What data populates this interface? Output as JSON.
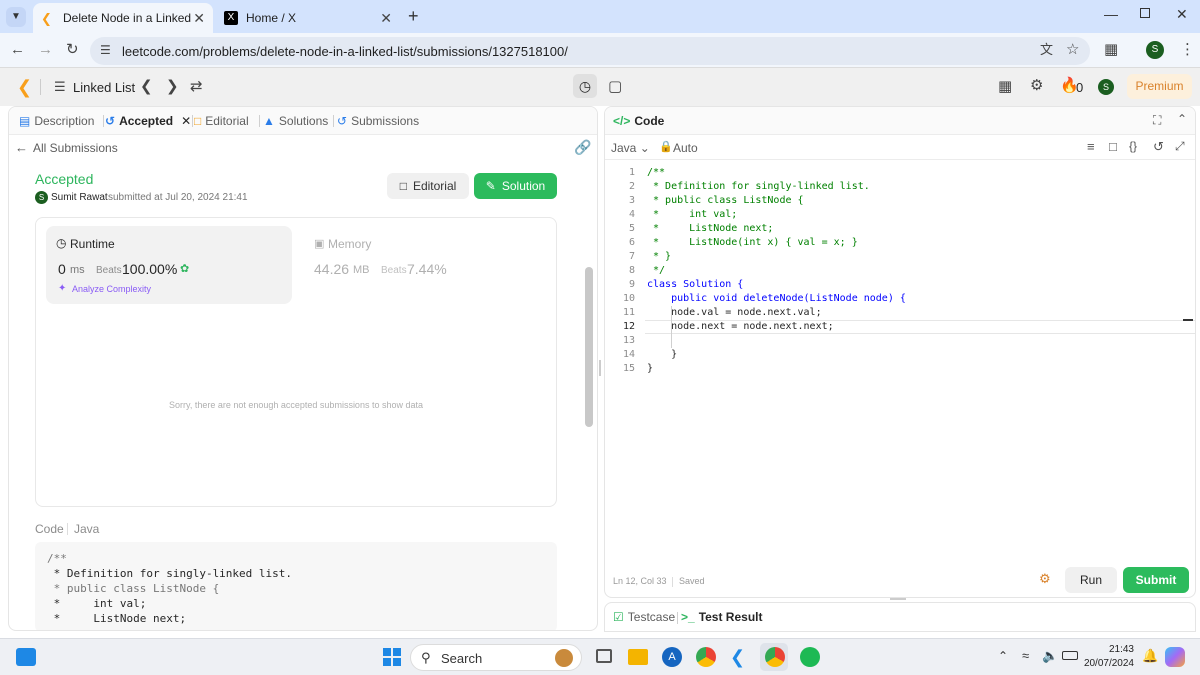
{
  "browser": {
    "tabs": [
      {
        "title": "Delete Node in a Linked List - L",
        "active": true
      },
      {
        "title": "Home / X",
        "active": false
      }
    ],
    "new_tab": "+",
    "url": "leetcode.com/problems/delete-node-in-a-linked-list/submissions/1327518100/",
    "profile_initial": "S"
  },
  "header": {
    "problem_list": "Linked List",
    "streak": "0",
    "avatar_initial": "S",
    "premium": "Premium"
  },
  "left_tabs": {
    "description": "Description",
    "accepted": "Accepted",
    "editorial": "Editorial",
    "solutions": "Solutions",
    "submissions": "Submissions"
  },
  "submission": {
    "back": "All Submissions",
    "status": "Accepted",
    "author_initial": "S",
    "author": "Sumit Rawat",
    "submitted": "submitted at Jul 20, 2024 21:41",
    "editorial_btn": "Editorial",
    "solution_btn": "Solution",
    "runtime_label": "Runtime",
    "runtime_value": "0",
    "runtime_unit": "ms",
    "runtime_beats_label": "Beats",
    "runtime_beats": "100.00%",
    "analyze": "Analyze Complexity",
    "memory_label": "Memory",
    "memory_value": "44.26",
    "memory_unit": "MB",
    "memory_beats_label": "Beats",
    "memory_beats": "7.44%",
    "no_data": "Sorry, there are not enough accepted submissions to show data",
    "code_label": "Code",
    "code_lang": "Java",
    "code_preview": [
      "/**",
      " * Definition for singly-linked list.",
      " * public class ListNode {",
      " *     int val;",
      " *     ListNode next;"
    ]
  },
  "editor": {
    "title": "Code",
    "language": "Java",
    "mode": "Auto",
    "status_pos": "Ln 12, Col 33",
    "status_saved": "Saved",
    "run": "Run",
    "submit": "Submit",
    "lines": [
      {
        "n": "1",
        "text": "/**"
      },
      {
        "n": "2",
        "text": " * Definition for singly-linked list."
      },
      {
        "n": "3",
        "text": " * public class ListNode {"
      },
      {
        "n": "4",
        "text": " *     int val;"
      },
      {
        "n": "5",
        "text": " *     ListNode next;"
      },
      {
        "n": "6",
        "text": " *     ListNode(int x) { val = x; }"
      },
      {
        "n": "7",
        "text": " * }"
      },
      {
        "n": "8",
        "text": " */"
      },
      {
        "n": "9",
        "text": "class Solution {"
      },
      {
        "n": "10",
        "text": "    public void deleteNode(ListNode node) {"
      },
      {
        "n": "11",
        "text": "    node.val = node.next.val;"
      },
      {
        "n": "12",
        "text": "    node.next = node.next.next;"
      },
      {
        "n": "13",
        "text": ""
      },
      {
        "n": "14",
        "text": "    }"
      },
      {
        "n": "15",
        "text": "}"
      }
    ]
  },
  "bottom_tabs": {
    "testcase": "Testcase",
    "result": "Test Result"
  },
  "taskbar": {
    "search": "Search",
    "time": "21:43",
    "date": "20/07/2024"
  },
  "colors": {
    "accepted_green": "#2db55d",
    "solution_btn": "#2cbb5d",
    "premium_bg": "#fdf0dc",
    "premium_text": "#d9822b",
    "comment_green": "#008000",
    "keyword_blue": "#0000ff",
    "type_teal": "#267f99"
  }
}
